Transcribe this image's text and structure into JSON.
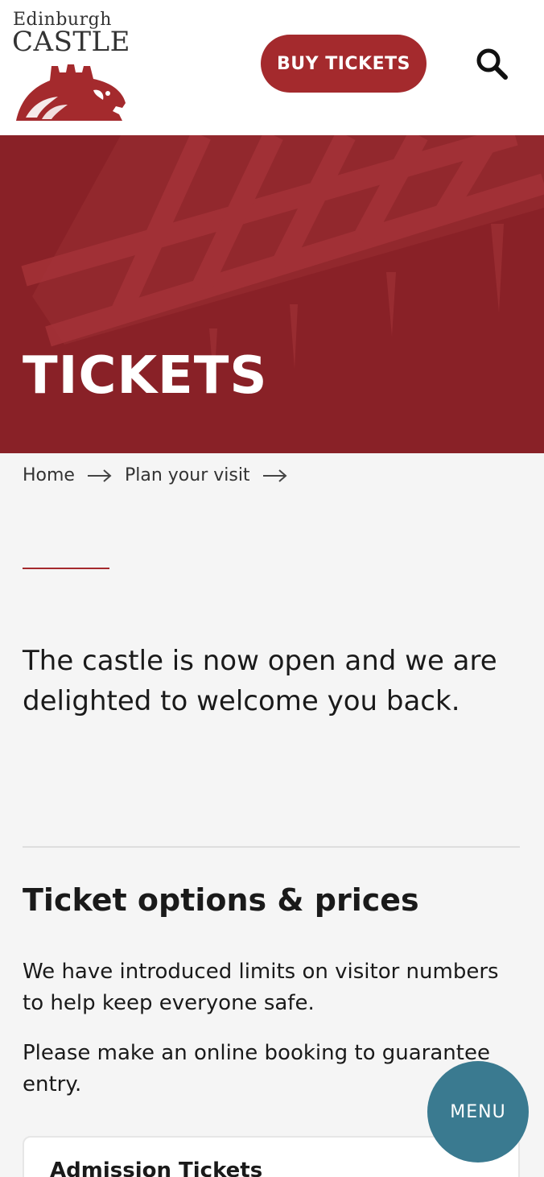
{
  "header": {
    "logo_line1": "Edinburgh",
    "logo_line2": "CASTLE",
    "buy_tickets_label": "BUY TICKETS",
    "search_icon": "search-icon"
  },
  "hero": {
    "title": "TICKETS"
  },
  "breadcrumb": {
    "items": [
      {
        "label": "Home"
      },
      {
        "label": "Plan your visit"
      }
    ],
    "separator_icon": "arrow-right-icon"
  },
  "intro": {
    "text": "The castle is now open and we are delighted to welcome you back."
  },
  "ticket_section": {
    "title": "Ticket options & prices",
    "paragraph1": "We have introduced limits on visitor numbers to help keep everyone safe.",
    "paragraph2": "Please make an online booking to guarantee entry.",
    "card_title": "Admission Tickets"
  },
  "menu": {
    "label": "MENU"
  },
  "colors": {
    "brand_red": "#a42a2d",
    "hero_red": "#8e2328",
    "menu_teal": "#3a7a90",
    "background": "#f5f5f5"
  }
}
